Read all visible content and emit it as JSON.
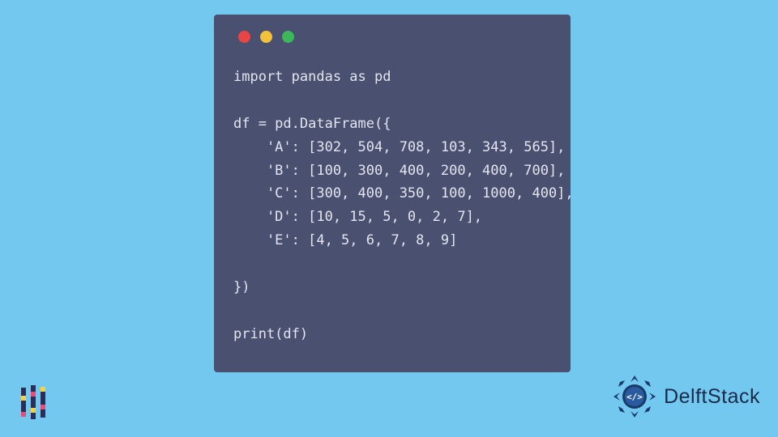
{
  "code_window": {
    "lines": [
      "import pandas as pd",
      "",
      "df = pd.DataFrame({",
      "    'A': [302, 504, 708, 103, 343, 565],",
      "    'B': [100, 300, 400, 200, 400, 700],",
      "    'C': [300, 400, 350, 100, 1000, 400],",
      "    'D': [10, 15, 5, 0, 2, 7],",
      "    'E': [4, 5, 6, 7, 8, 9]",
      "",
      "})",
      "",
      "print(df)"
    ]
  },
  "branding": {
    "right_text": "DelftStack"
  },
  "colors": {
    "background": "#73c8f0",
    "window": "#4a5070",
    "code_text": "#e3e5ef",
    "dot_red": "#e84545",
    "dot_yellow": "#f3c13a",
    "dot_green": "#3cb85a",
    "brand_blue": "#1a2a4a"
  }
}
